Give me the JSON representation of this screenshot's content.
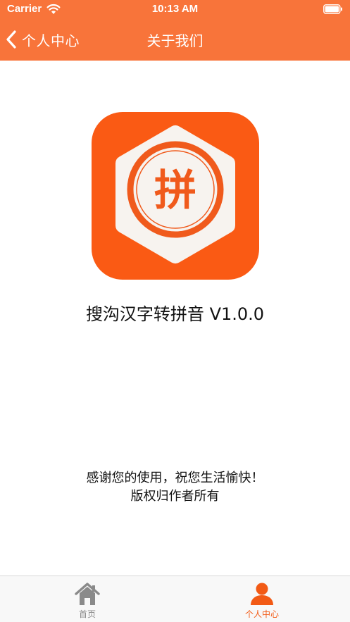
{
  "status_bar": {
    "carrier": "Carrier",
    "time": "10:13 AM"
  },
  "nav": {
    "back_label": "个人中心",
    "title": "关于我们"
  },
  "logo": {
    "glyph": "拼"
  },
  "content": {
    "app_title": "搜沟汉字转拼音 V1.0.0",
    "thanks": "感谢您的使用，祝您生活愉快！",
    "copyright": "版权归作者所有"
  },
  "tabs": [
    {
      "label": "首页",
      "icon": "home-icon",
      "active": false
    },
    {
      "label": "个人中心",
      "icon": "person-icon",
      "active": true
    }
  ],
  "colors": {
    "header": "#f8743a",
    "logo_bg": "#fa5a14",
    "logo_inner": "#f7f3ef",
    "active_tab": "#f25a15",
    "inactive_tab": "#8a8a8a"
  }
}
